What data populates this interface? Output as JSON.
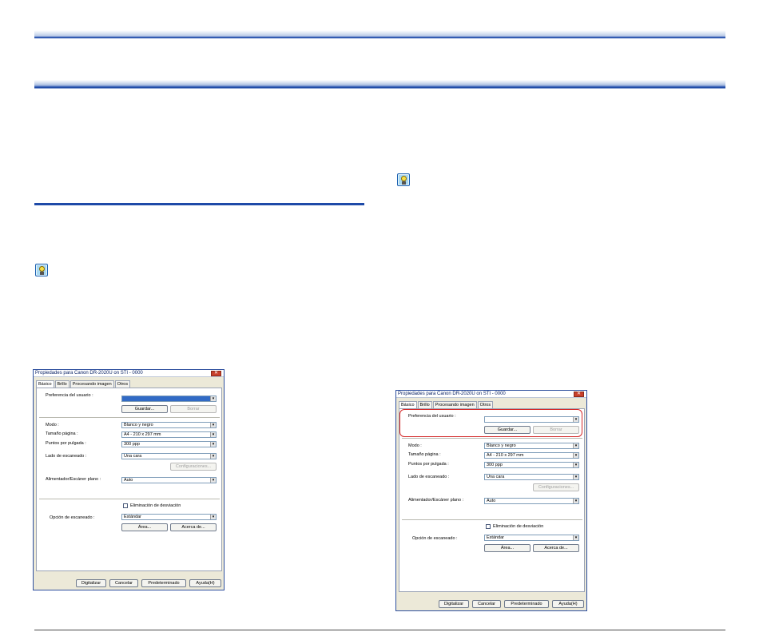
{
  "dialog": {
    "title": "Propiedades para Canon DR-2020U on STI - 0000",
    "close_glyph": "✕",
    "tabs": [
      "Básico",
      "Brillo",
      "Procesando imagen",
      "Otros"
    ],
    "labels": {
      "user_pref": "Preferencia del usuario :",
      "mode": "Modo :",
      "page_size": "Tamaño página :",
      "dpi": "Puntos por pulgada :",
      "scan_side": "Lado de escaneado :",
      "feeder": "Alimentador/Escáner plano :",
      "deskew": "Eliminación de desviación",
      "scan_option": "Opción de escaneado :"
    },
    "values": {
      "user_pref": "",
      "mode": "Blanco y negro",
      "page_size": "A4 - 210 x 297 mm",
      "dpi": "300 ppp",
      "scan_side": "Una cara",
      "feeder": "Auto",
      "scan_option": "Estándar"
    },
    "buttons": {
      "save": "Guardar...",
      "delete": "Borrar",
      "settings": "Configuraciones...",
      "area": "Área...",
      "about": "Acerca de...",
      "scan": "Digitalizar",
      "cancel": "Cancelar",
      "default": "Predeterminado",
      "help": "Ayuda(H)"
    },
    "dropdown_glyph": "▾"
  }
}
